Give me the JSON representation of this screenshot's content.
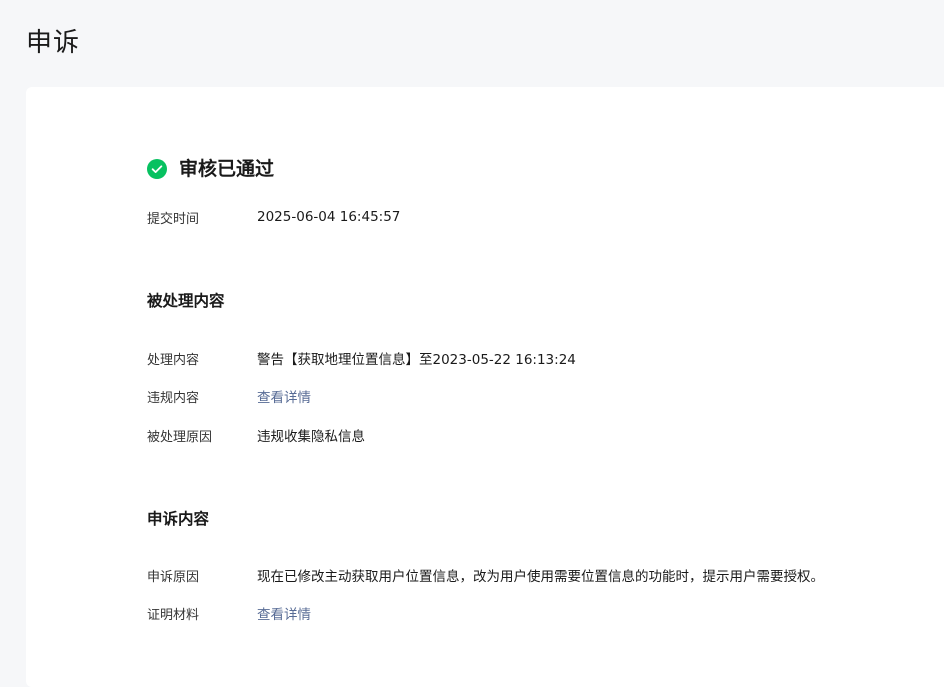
{
  "page": {
    "title": "申诉"
  },
  "status": {
    "icon": "check-circle-icon",
    "text": "审核已通过",
    "color": "#07c160"
  },
  "submit": {
    "label": "提交时间",
    "value": "2025-06-04 16:45:57"
  },
  "processed": {
    "title": "被处理内容",
    "rows": [
      {
        "label": "处理内容",
        "value": "警告【获取地理位置信息】至2023-05-22 16:13:24"
      },
      {
        "label": "违规内容",
        "value": "查看详情"
      },
      {
        "label": "被处理原因",
        "value": "违规收集隐私信息"
      }
    ]
  },
  "appeal": {
    "title": "申诉内容",
    "rows": [
      {
        "label": "申诉原因",
        "value": "现在已修改主动获取用户位置信息，改为用户使用需要位置信息的功能时，提示用户需要授权。"
      },
      {
        "label": "证明材料",
        "value": "查看详情"
      }
    ]
  },
  "colors": {
    "link": "#576b95",
    "background": "#f6f7f9",
    "card": "#ffffff"
  }
}
